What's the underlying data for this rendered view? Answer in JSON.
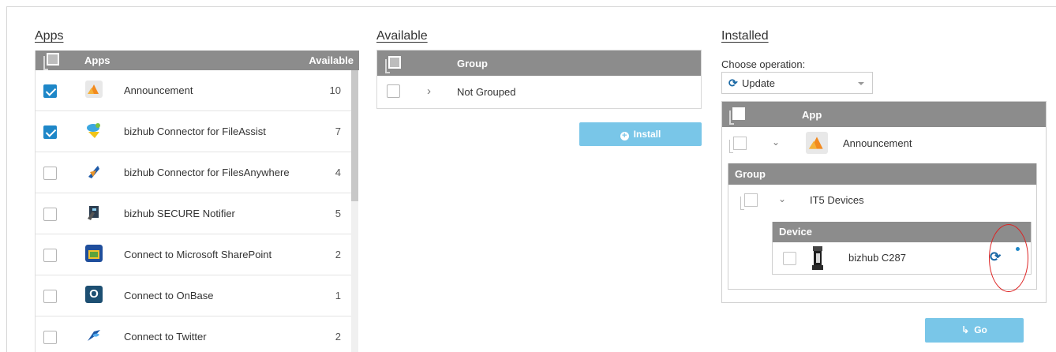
{
  "apps_section": {
    "title": "Apps",
    "header": {
      "col_apps": "Apps",
      "col_available": "Available"
    },
    "rows": [
      {
        "name": "Announcement",
        "count": "10",
        "checked": true,
        "icon": "announcement-icon"
      },
      {
        "name": "bizhub Connector for FileAssist",
        "count": "7",
        "checked": true,
        "icon": "fileassist-icon"
      },
      {
        "name": "bizhub Connector for FilesAnywhere",
        "count": "4",
        "checked": false,
        "icon": "filesanywhere-icon"
      },
      {
        "name": "bizhub SECURE Notifier",
        "count": "5",
        "checked": false,
        "icon": "secure-notifier-icon"
      },
      {
        "name": "Connect to Microsoft SharePoint",
        "count": "2",
        "checked": false,
        "icon": "sharepoint-icon"
      },
      {
        "name": "Connect to OnBase",
        "count": "1",
        "checked": false,
        "icon": "onbase-icon"
      },
      {
        "name": "Connect to Twitter",
        "count": "2",
        "checked": false,
        "icon": "twitter-icon"
      }
    ],
    "onbase_letter": "O"
  },
  "available_section": {
    "title": "Available",
    "header": {
      "col_group": "Group"
    },
    "row": {
      "chevron": "›",
      "label": "Not Grouped"
    },
    "install_label": "Install"
  },
  "installed_section": {
    "title": "Installed",
    "choose_label": "Choose operation:",
    "operation": {
      "value": "Update",
      "icon": "refresh-icon"
    },
    "app_header": "App",
    "app_row": {
      "chevron": "⌄",
      "name": "Announcement"
    },
    "group_header": "Group",
    "group_row": {
      "chevron": "⌄",
      "name": "IT5 Devices"
    },
    "device_header": "Device",
    "device_row": {
      "name": "bizhub C287"
    },
    "go_label": "Go",
    "go_icon": "↳"
  },
  "colors": {
    "header_bg": "#8c8c8c",
    "check_blue": "#1e87c8",
    "button_bg": "#79c6e8",
    "refresh_blue": "#1c6aa6",
    "highlight_red": "#d22222"
  }
}
